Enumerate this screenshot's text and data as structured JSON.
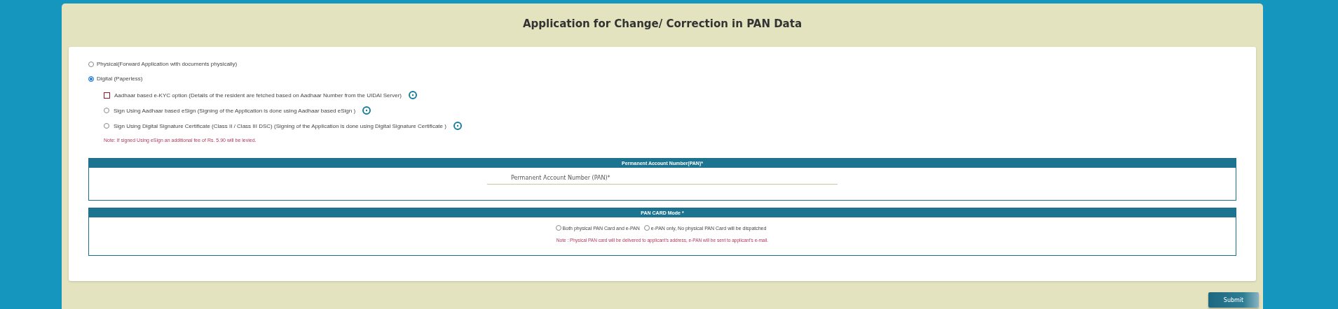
{
  "title": "Application for Change/ Correction in PAN Data",
  "modes": [
    {
      "label": "Physical(Forward Application with documents physically)",
      "selected": false
    },
    {
      "label": "Digital (Paperless)",
      "selected": true
    }
  ],
  "digital_options": [
    {
      "kind": "checkbox",
      "label": "Aadhaar based e-KYC option (Details of the resident are fetched based on Aadhaar Number from the UIDAI Server)",
      "checked": false
    },
    {
      "kind": "radio",
      "label": "Sign Using Aadhaar based eSign (Signing of the Application is done using Aadhaar based eSign )",
      "checked": false
    },
    {
      "kind": "radio",
      "label": "Sign Using Digital Signature Certificate (Class II / Class III DSC) (Signing of the Application is done using Digital Signature Certificate )",
      "checked": false
    }
  ],
  "esign_note": "Note: If signed Using eSign an additional fee of Rs. 5.90 will be levied.",
  "pan_section": {
    "header": "Permanent Account Number(PAN)*",
    "placeholder": "Permanent Account Number (PAN)*"
  },
  "card_mode_section": {
    "header": "PAN CARD Mode *",
    "options": [
      {
        "label": "Both physical PAN Card and e-PAN",
        "selected": false
      },
      {
        "label": "e-PAN only, No physical PAN Card will be dispatched",
        "selected": false
      }
    ],
    "note": "Note : Physical PAN card will be delivered to applicant’s address, e-PAN will be sent to applicant’s e-mail."
  },
  "submit": "Submit"
}
